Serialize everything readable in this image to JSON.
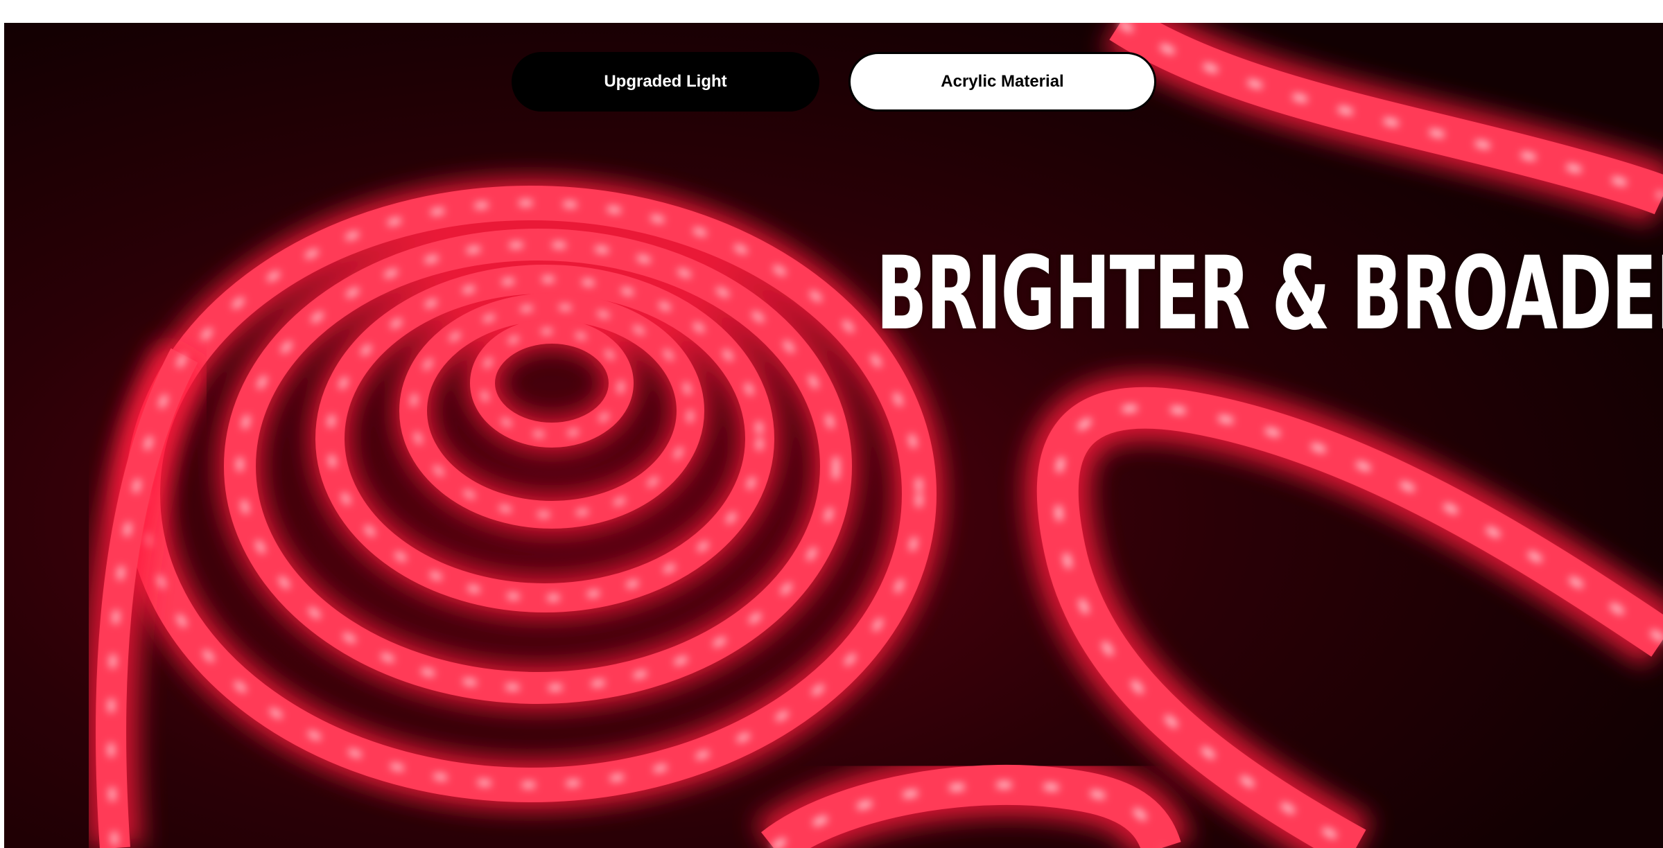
{
  "tabs": [
    {
      "label": "Upgraded Light",
      "state": "active"
    },
    {
      "label": "Acrylic Material",
      "state": "inactive"
    }
  ],
  "hero": {
    "headline": "BRIGHTER & BROADER",
    "image_subject": "glowing red LED strip lights"
  },
  "colors": {
    "background": "#160003",
    "led_glow": "#ff1e3c",
    "led_core": "#ffd6dc",
    "tab_active_bg": "#000000",
    "tab_inactive_bg": "#ffffff",
    "headline": "#ffffff"
  }
}
